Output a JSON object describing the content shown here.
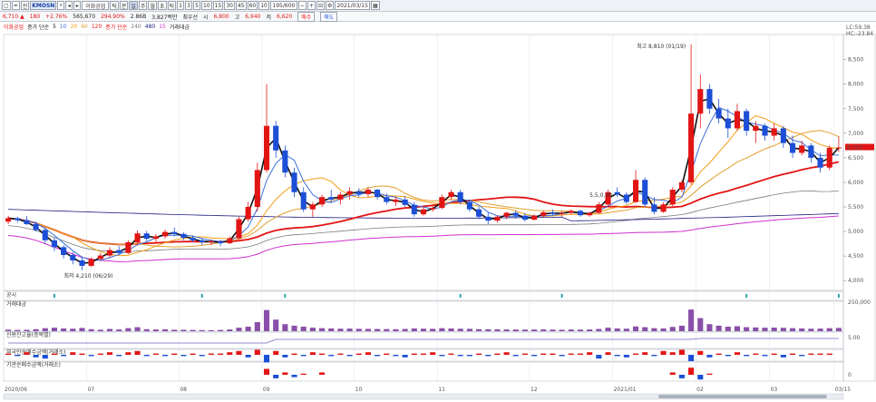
{
  "toolbar": {
    "items": [
      "▢",
      "≐",
      "전",
      "",
      "",
      "◂",
      "▸",
      "",
      "",
      "",
      "",
      "≡",
      "",
      "",
      "",
      "",
      "",
      "",
      "",
      "",
      "",
      "",
      "",
      "",
      "",
      "",
      "",
      "",
      "",
      ""
    ],
    "code": "KMOSN",
    "stock_name": "이화공업",
    "periods": [
      "틱",
      "분",
      "일",
      "주",
      "월",
      "초",
      "틱"
    ],
    "minutes": [
      "1",
      "3",
      "5",
      "10",
      "15",
      "30",
      "45",
      "60",
      "10"
    ],
    "count": "195/600",
    "date": "2021/03/15",
    "right_buttons": [
      "매수",
      "매도"
    ]
  },
  "quote": {
    "price": "6,710 ▲",
    "change": "180",
    "change_pct": "+2.76%",
    "volume": "565,670",
    "vol_ratio": "294.90%",
    "turnover": "2.86B",
    "amount": "3,827백만",
    "order": "최우선",
    "open_label": "시",
    "open": "6,800",
    "high_label": "고",
    "high": "6,940",
    "low_label": "저",
    "low": "6,620",
    "current": "6,710",
    "current_rise": "6,780"
  },
  "legend": {
    "name": "이화공업",
    "ma_price_label": "종가 단순",
    "ma_price": [
      "5",
      "10",
      "20",
      "60",
      "120"
    ],
    "ma_vol_label": "종가 단순",
    "ma_vol": [
      "240",
      "480",
      "15"
    ],
    "trade_label": "거래대금"
  },
  "right_top": {
    "lc": "LC:59.38",
    "hc": "HC:-23.84"
  },
  "annotations": {
    "high": "최고 8,810 (01/19)",
    "low": "최저 4,210 (06/29)",
    "mid": "5,5,0.00"
  },
  "subpanels": [
    {
      "label": "공시",
      "color": "#2aa6a6"
    },
    {
      "label": "거래대금",
      "color": "#333"
    },
    {
      "label": "신용잔고율(증목별)",
      "color": "#333"
    },
    {
      "label": "외국인순매수금액(거래소)",
      "color": "#333"
    },
    {
      "label": "기관순매수금액(거래소)",
      "color": "#333"
    }
  ],
  "x_ticks": [
    "2020/06",
    "07",
    "08",
    "09",
    "10",
    "11",
    "12",
    "2021/01",
    "02",
    "03",
    "03/15"
  ],
  "price_axis": [
    "8,500",
    "8,000",
    "7,500",
    "7,000",
    "6,500",
    "6,000",
    "5,500",
    "5,000",
    "4,500",
    "4,000"
  ],
  "vol_axis": "250,000",
  "credit_axis": "5.00",
  "inst_axis": "0",
  "colors": {
    "up": "#e21414",
    "down": "#1c4fd6",
    "ma5": "#111111",
    "ma10": "#3b6fd8",
    "ma20": "#f39c12",
    "ma60": "#e0a030",
    "ma120": "#e21414",
    "ma240": "#7a7a7a",
    "ma480": "#1a1a80",
    "ma15": "#d02fd0"
  },
  "chart_data": {
    "type": "candlestick",
    "y_range": [
      3800,
      8900
    ],
    "candles": [
      [
        5200,
        5320,
        5150,
        5270
      ],
      [
        5270,
        5300,
        5180,
        5230
      ],
      [
        5230,
        5310,
        5130,
        5150
      ],
      [
        5150,
        5200,
        5000,
        5030
      ],
      [
        5030,
        5080,
        4750,
        4820
      ],
      [
        4820,
        4880,
        4600,
        4680
      ],
      [
        4680,
        4720,
        4450,
        4520
      ],
      [
        4520,
        4580,
        4330,
        4410
      ],
      [
        4410,
        4480,
        4210,
        4300
      ],
      [
        4300,
        4470,
        4280,
        4440
      ],
      [
        4440,
        4560,
        4400,
        4510
      ],
      [
        4510,
        4680,
        4470,
        4620
      ],
      [
        4620,
        4700,
        4520,
        4560
      ],
      [
        4560,
        4820,
        4540,
        4780
      ],
      [
        4780,
        5020,
        4720,
        4960
      ],
      [
        4960,
        5010,
        4800,
        4850
      ],
      [
        4850,
        4950,
        4760,
        4900
      ],
      [
        4900,
        5040,
        4850,
        4990
      ],
      [
        4990,
        5080,
        4900,
        4950
      ],
      [
        4950,
        4980,
        4820,
        4870
      ],
      [
        4870,
        4920,
        4780,
        4820
      ],
      [
        4820,
        4860,
        4720,
        4780
      ],
      [
        4780,
        4840,
        4720,
        4800
      ],
      [
        4800,
        4830,
        4700,
        4760
      ],
      [
        4760,
        4900,
        4740,
        4860
      ],
      [
        4860,
        5300,
        4840,
        5250
      ],
      [
        5250,
        5600,
        5200,
        5500
      ],
      [
        5500,
        6400,
        5400,
        6250
      ],
      [
        6250,
        8000,
        6200,
        7150
      ],
      [
        7150,
        7250,
        6500,
        6650
      ],
      [
        6650,
        6750,
        6100,
        6200
      ],
      [
        6200,
        6300,
        5700,
        5800
      ],
      [
        5800,
        5900,
        5400,
        5450
      ],
      [
        5450,
        5600,
        5300,
        5550
      ],
      [
        5550,
        5750,
        5500,
        5700
      ],
      [
        5700,
        5850,
        5600,
        5650
      ],
      [
        5650,
        5800,
        5550,
        5750
      ],
      [
        5750,
        5900,
        5650,
        5820
      ],
      [
        5820,
        5880,
        5700,
        5760
      ],
      [
        5760,
        5900,
        5700,
        5850
      ],
      [
        5850,
        5870,
        5650,
        5700
      ],
      [
        5700,
        5780,
        5550,
        5600
      ],
      [
        5600,
        5700,
        5520,
        5650
      ],
      [
        5650,
        5720,
        5500,
        5540
      ],
      [
        5540,
        5600,
        5300,
        5350
      ],
      [
        5350,
        5500,
        5320,
        5450
      ],
      [
        5450,
        5550,
        5400,
        5480
      ],
      [
        5480,
        5750,
        5450,
        5700
      ],
      [
        5700,
        5850,
        5650,
        5800
      ],
      [
        5800,
        5850,
        5550,
        5600
      ],
      [
        5600,
        5650,
        5400,
        5450
      ],
      [
        5450,
        5500,
        5250,
        5300
      ],
      [
        5300,
        5380,
        5150,
        5220
      ],
      [
        5220,
        5330,
        5180,
        5300
      ],
      [
        5300,
        5400,
        5250,
        5380
      ],
      [
        5380,
        5420,
        5260,
        5320
      ],
      [
        5320,
        5380,
        5200,
        5240
      ],
      [
        5240,
        5350,
        5220,
        5320
      ],
      [
        5320,
        5420,
        5290,
        5390
      ],
      [
        5390,
        5450,
        5330,
        5360
      ],
      [
        5360,
        5420,
        5300,
        5380
      ],
      [
        5380,
        5450,
        5350,
        5420
      ],
      [
        5420,
        5440,
        5300,
        5330
      ],
      [
        5330,
        5400,
        5300,
        5380
      ],
      [
        5380,
        5600,
        5360,
        5550
      ],
      [
        5550,
        5850,
        5500,
        5800
      ],
      [
        5800,
        5900,
        5700,
        5750
      ],
      [
        5750,
        5800,
        5550,
        5600
      ],
      [
        5600,
        6250,
        5580,
        6050
      ],
      [
        6050,
        6100,
        5500,
        5550
      ],
      [
        5550,
        5700,
        5350,
        5400
      ],
      [
        5400,
        5600,
        5380,
        5550
      ],
      [
        5550,
        5900,
        5500,
        5850
      ],
      [
        5850,
        6050,
        5800,
        6000
      ],
      [
        6000,
        8810,
        5950,
        7400
      ],
      [
        7400,
        8200,
        7100,
        7900
      ],
      [
        7900,
        8000,
        7400,
        7500
      ],
      [
        7500,
        7700,
        7200,
        7300
      ],
      [
        7300,
        7500,
        6900,
        7100
      ],
      [
        7100,
        7600,
        7050,
        7450
      ],
      [
        7450,
        7500,
        6950,
        7050
      ],
      [
        7050,
        7250,
        6800,
        7150
      ],
      [
        7150,
        7200,
        6850,
        6950
      ],
      [
        6950,
        7200,
        6850,
        7100
      ],
      [
        7100,
        7150,
        6700,
        6800
      ],
      [
        6800,
        6950,
        6500,
        6600
      ],
      [
        6600,
        6850,
        6550,
        6750
      ],
      [
        6750,
        6800,
        6400,
        6500
      ],
      [
        6500,
        6600,
        6200,
        6300
      ],
      [
        6300,
        6750,
        6250,
        6700
      ],
      [
        6700,
        6940,
        6620,
        6710
      ]
    ],
    "volume": [
      30,
      25,
      28,
      40,
      60,
      70,
      55,
      50,
      65,
      40,
      30,
      45,
      35,
      60,
      80,
      40,
      35,
      38,
      30,
      28,
      25,
      22,
      20,
      25,
      35,
      70,
      90,
      180,
      420,
      230,
      140,
      110,
      90,
      70,
      60,
      55,
      50,
      52,
      48,
      46,
      44,
      42,
      40,
      45,
      55,
      50,
      48,
      60,
      55,
      50,
      48,
      40,
      38,
      36,
      35,
      34,
      33,
      34,
      36,
      32,
      30,
      34,
      32,
      35,
      45,
      70,
      55,
      50,
      95,
      80,
      60,
      55,
      85,
      110,
      430,
      260,
      140,
      110,
      90,
      100,
      80,
      75,
      70,
      72,
      68,
      60,
      55,
      50,
      52,
      60,
      65
    ],
    "foreign": [
      1,
      -1,
      2,
      -2,
      -3,
      1,
      -1,
      2,
      1,
      -1,
      1,
      2,
      -1,
      2,
      3,
      -1,
      1,
      -1,
      1,
      -1,
      1,
      -1,
      1,
      1,
      2,
      3,
      -2,
      4,
      -6,
      3,
      -2,
      1,
      -1,
      2,
      1,
      -1,
      1,
      -1,
      1,
      2,
      -1,
      1,
      -1,
      -2,
      1,
      1,
      2,
      -1,
      1,
      -1,
      -1,
      1,
      -1,
      1,
      2,
      -1,
      1,
      -1,
      1,
      1,
      -1,
      1,
      1,
      2,
      -3,
      2,
      -1,
      -2,
      1,
      2,
      -1,
      3,
      2,
      4,
      -5,
      3,
      -2,
      1,
      -1,
      2,
      -1,
      1,
      -1,
      1,
      -2,
      1,
      -1,
      1,
      1,
      1
    ],
    "institution": [
      0,
      0,
      0,
      0,
      0,
      0,
      0,
      0,
      0,
      0,
      0,
      0,
      0,
      0,
      0,
      0,
      0,
      0,
      0,
      0,
      0,
      0,
      0,
      0,
      0,
      0,
      0,
      0,
      5,
      -3,
      2,
      -2,
      1,
      0,
      2,
      0,
      0,
      0,
      0,
      0,
      0,
      0,
      0,
      0,
      0,
      0,
      0,
      0,
      0,
      0,
      0,
      0,
      0,
      0,
      0,
      0,
      0,
      0,
      0,
      0,
      0,
      0,
      0,
      0,
      0,
      0,
      0,
      0,
      0,
      0,
      0,
      0,
      2,
      -3,
      6,
      -4,
      1,
      0,
      0,
      0,
      0,
      0,
      0,
      0,
      0,
      0,
      0,
      0,
      0,
      0,
      0
    ]
  }
}
